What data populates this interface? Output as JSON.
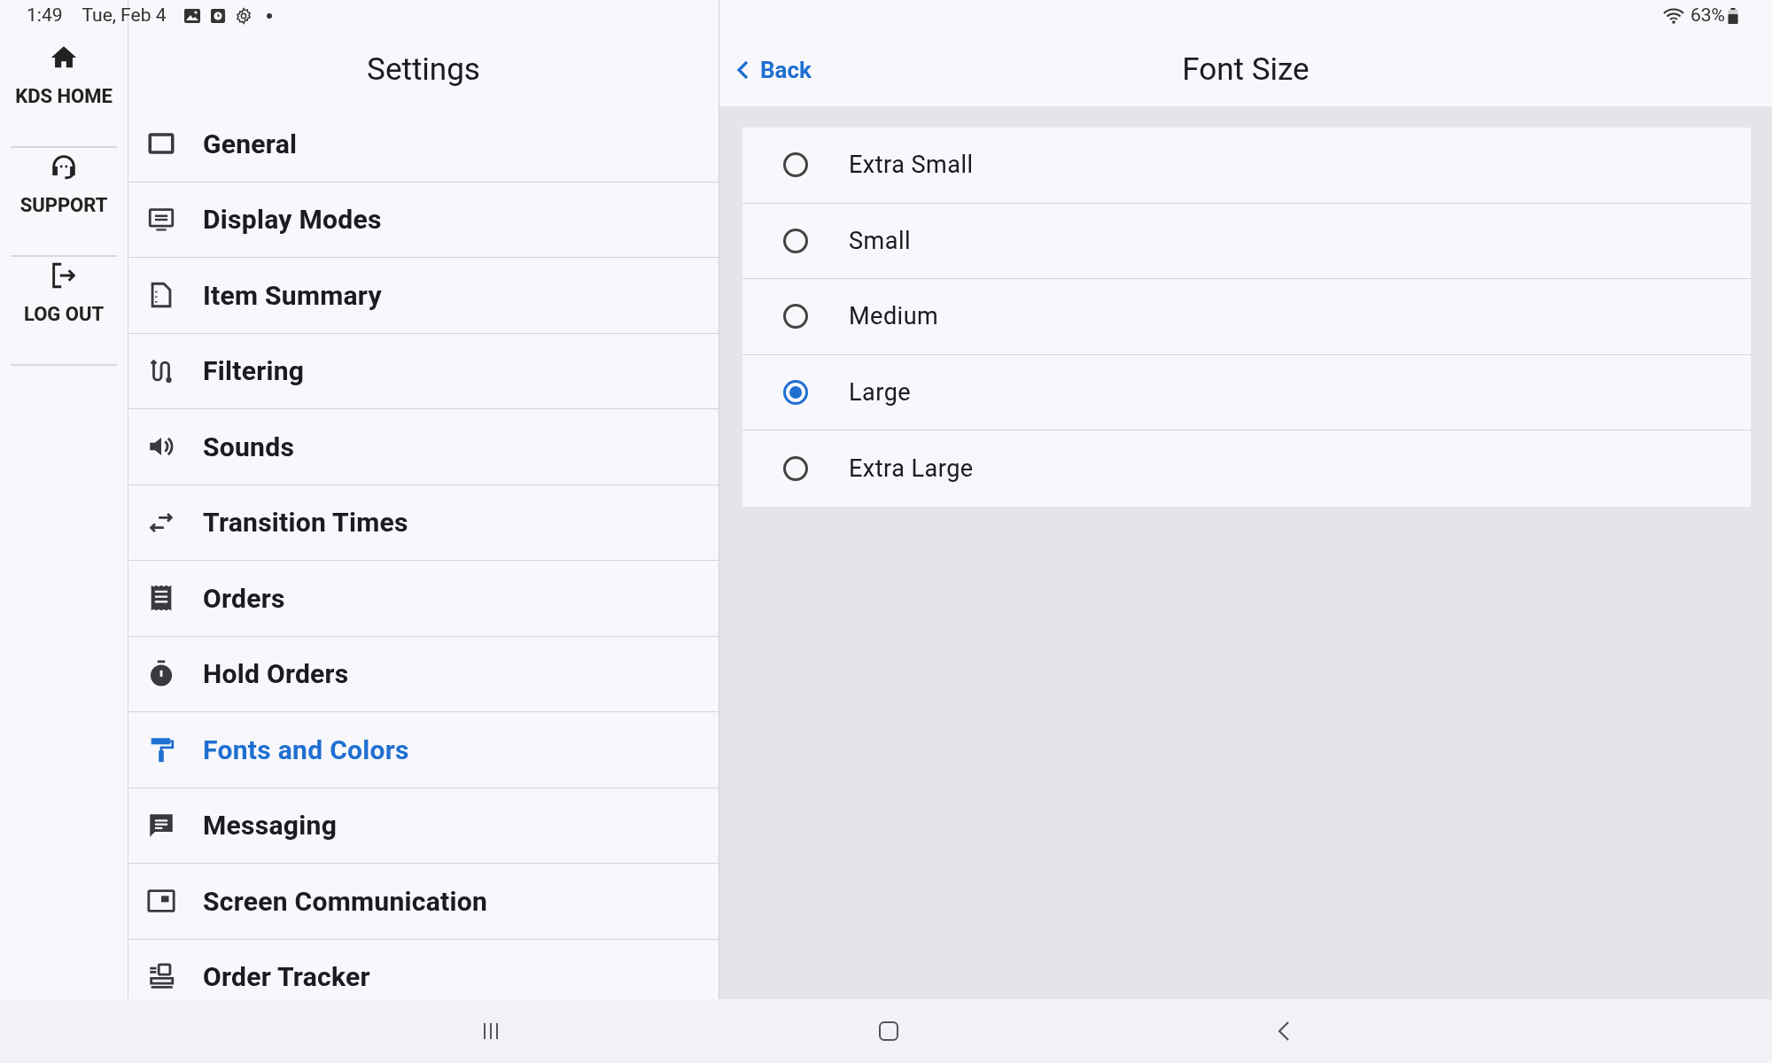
{
  "status_bar": {
    "time": "1:49",
    "date": "Tue, Feb 4",
    "battery": "63%"
  },
  "rail": [
    {
      "label": "KDS HOME"
    },
    {
      "label": "SUPPORT"
    },
    {
      "label": "LOG OUT"
    }
  ],
  "settings": {
    "title": "Settings",
    "items": [
      {
        "label": "General",
        "selected": false
      },
      {
        "label": "Display Modes",
        "selected": false
      },
      {
        "label": "Item Summary",
        "selected": false
      },
      {
        "label": "Filtering",
        "selected": false
      },
      {
        "label": "Sounds",
        "selected": false
      },
      {
        "label": "Transition Times",
        "selected": false
      },
      {
        "label": "Orders",
        "selected": false
      },
      {
        "label": "Hold Orders",
        "selected": false
      },
      {
        "label": "Fonts and Colors",
        "selected": true
      },
      {
        "label": "Messaging",
        "selected": false
      },
      {
        "label": "Screen Communication",
        "selected": false
      },
      {
        "label": "Order Tracker",
        "selected": false
      }
    ]
  },
  "detail": {
    "back": "Back",
    "title": "Font Size",
    "options": [
      {
        "label": "Extra Small",
        "selected": false
      },
      {
        "label": "Small",
        "selected": false
      },
      {
        "label": "Medium",
        "selected": false
      },
      {
        "label": "Large",
        "selected": true
      },
      {
        "label": "Extra Large",
        "selected": false
      }
    ]
  }
}
